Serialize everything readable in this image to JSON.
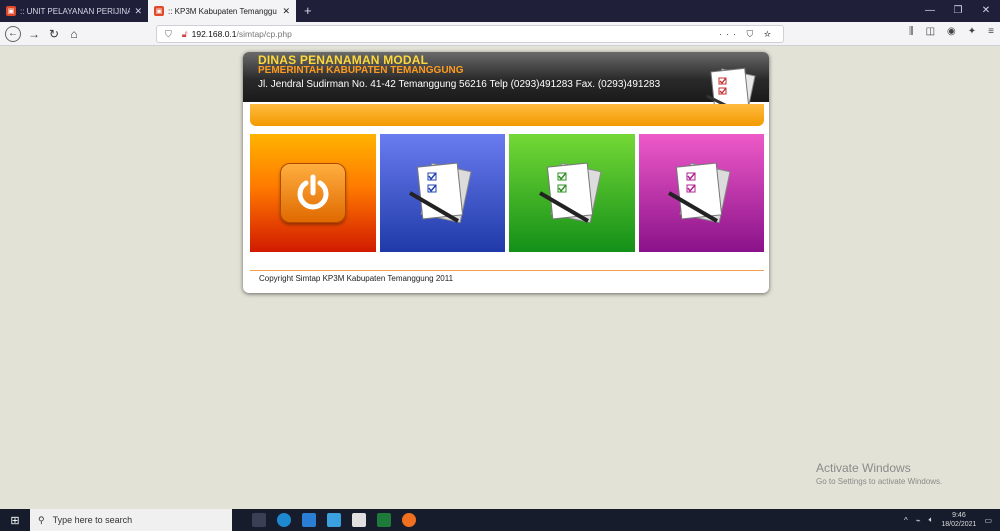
{
  "browser": {
    "tabs": [
      {
        "label": ":: UNIT PELAYANAN PERIJINAN",
        "active": false
      },
      {
        "label": ":: KP3M Kabupaten Temanggu",
        "active": true
      }
    ],
    "url_host": "192.168.0.1",
    "url_path": "/simtap/cp.php"
  },
  "header": {
    "title_line1": "DINAS PENANAMAN MODAL",
    "title_line2": "PEMERINTAH KABUPATEN TEMANGGUNG",
    "address": "Jl. Jendral Sudirman No. 41-42 Temanggung 56216 Telp (0293)491283 Fax. (0293)491283"
  },
  "tiles": [
    {
      "icon": "power-icon",
      "color_top": "#ffb300",
      "color_bottom": "#d11a00"
    },
    {
      "icon": "documents-icon",
      "color_top": "#6a7cf0",
      "color_bottom": "#1f3aa8"
    },
    {
      "icon": "documents-icon",
      "color_top": "#74d836",
      "color_bottom": "#139018"
    },
    {
      "icon": "documents-icon",
      "color_top": "#ee5ac8",
      "color_bottom": "#8a128a"
    }
  ],
  "footer": {
    "copyright": "Copyright Simtap KP3M Kabupaten Temanggung 2011"
  },
  "watermark": {
    "line1": "Activate Windows",
    "line2": "Go to Settings to activate Windows."
  },
  "taskbar": {
    "search_placeholder": "Type here to search",
    "time": "9:46",
    "date": "18/02/2021"
  }
}
